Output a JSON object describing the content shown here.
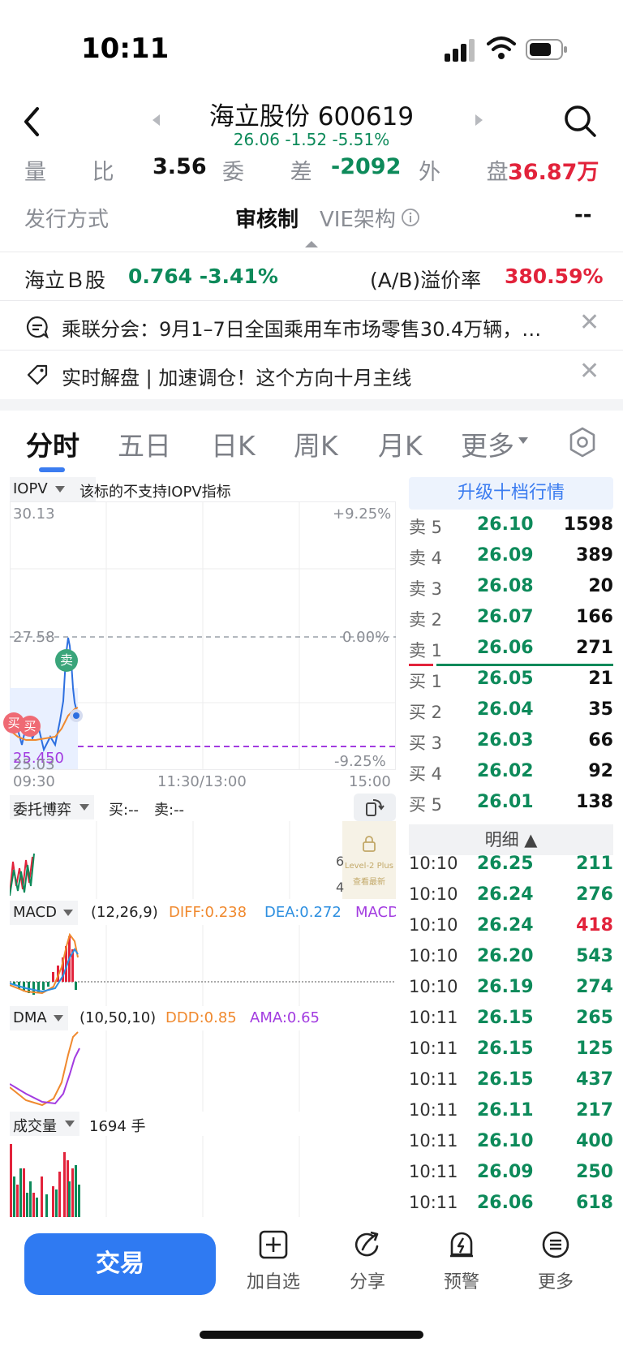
{
  "status_bar": {
    "time": "10:11"
  },
  "header": {
    "title": "海立股份 600619",
    "quote": "26.06  -1.52  -5.51%"
  },
  "stats": {
    "volume_ratio_label": "量  比",
    "volume_ratio": "3.56",
    "commission_diff_label": "委  差",
    "commission_diff": "-2092",
    "outer_label": "外  盘",
    "outer_value": "36.87万"
  },
  "issuance": {
    "label": "发行方式",
    "method": "审核制",
    "vie_label": "VIE架构",
    "vie_value": "--"
  },
  "b_share": {
    "label": "海立Ｂ股",
    "value": "0.764 -3.41%",
    "premium_label": "(A/B)溢价率",
    "premium_value": "380.59%"
  },
  "news": [
    {
      "text": "乘联分会：9月1–7日全国乘用车市场零售30.4万辆，…",
      "icon": "comment-icon"
    },
    {
      "text": "实时解盘 | 加速调仓！这个方向十月主线",
      "icon": "tag-icon"
    }
  ],
  "tabs": [
    "分时",
    "五日",
    "日K",
    "周K",
    "月K",
    "更多"
  ],
  "chart": {
    "indicator_select": "IOPV",
    "indicator_note": "该标的不支持IOPV指标",
    "price_high": "30.13",
    "price_mid": "27.58",
    "price_low_a": "25.450",
    "price_low_b": "25.03",
    "pct_high": "+9.25%",
    "pct_mid": "0.00%",
    "pct_low": "-9.25%",
    "time_start": "09:30",
    "time_mid": "11:30/13:00",
    "time_end": "15:00",
    "sell_marker": "卖",
    "buy_marker": "买",
    "entrust_label": "委托博弈",
    "entrust_buy": "买:--",
    "entrust_sell": "卖:--",
    "level2_line1": "Level-2 Plus",
    "level2_line2": "查看最新",
    "macd_label": "MACD",
    "macd_params": "(12,26,9)",
    "macd_diff": "DIFF:0.238",
    "macd_dea": "DEA:0.272",
    "macd_macd": "MACD",
    "dma_label": "DMA",
    "dma_params": "(10,50,10)",
    "dma_ddd": "DDD:0.85",
    "dma_ama": "AMA:0.65",
    "vol_label": "成交量",
    "vol_value": "1694 手"
  },
  "order_book": {
    "upgrade": "升级十档行情",
    "asks": [
      {
        "label": "卖 5",
        "price": "26.10",
        "vol": "1598"
      },
      {
        "label": "卖 4",
        "price": "26.09",
        "vol": "389"
      },
      {
        "label": "卖 3",
        "price": "26.08",
        "vol": "20"
      },
      {
        "label": "卖 2",
        "price": "26.07",
        "vol": "166"
      },
      {
        "label": "卖 1",
        "price": "26.06",
        "vol": "271"
      }
    ],
    "bids": [
      {
        "label": "买 1",
        "price": "26.05",
        "vol": "21"
      },
      {
        "label": "买 2",
        "price": "26.04",
        "vol": "35"
      },
      {
        "label": "买 3",
        "price": "26.03",
        "vol": "66"
      },
      {
        "label": "买 4",
        "price": "26.02",
        "vol": "92"
      },
      {
        "label": "买 5",
        "price": "26.01",
        "vol": "138"
      }
    ],
    "detail_label": "明细"
  },
  "ticks": [
    {
      "time": "10:10",
      "price": "26.25",
      "vol": "211"
    },
    {
      "time": "10:10",
      "price": "26.24",
      "vol": "276"
    },
    {
      "time": "10:10",
      "price": "26.24",
      "vol": "418"
    },
    {
      "time": "10:10",
      "price": "26.20",
      "vol": "543"
    },
    {
      "time": "10:10",
      "price": "26.19",
      "vol": "274"
    },
    {
      "time": "10:11",
      "price": "26.15",
      "vol": "265"
    },
    {
      "time": "10:11",
      "price": "26.15",
      "vol": "125"
    },
    {
      "time": "10:11",
      "price": "26.15",
      "vol": "437"
    },
    {
      "time": "10:11",
      "price": "26.11",
      "vol": "217"
    },
    {
      "time": "10:11",
      "price": "26.10",
      "vol": "400"
    },
    {
      "time": "10:11",
      "price": "26.09",
      "vol": "250"
    },
    {
      "time": "10:11",
      "price": "26.06",
      "vol": "618"
    }
  ],
  "bottom_bar": {
    "trade": "交易",
    "items": [
      {
        "label": "加自选",
        "icon": "add-watchlist-icon"
      },
      {
        "label": "分享",
        "icon": "share-icon"
      },
      {
        "label": "预警",
        "icon": "alert-icon"
      },
      {
        "label": "更多",
        "icon": "more-icon"
      }
    ]
  },
  "colors": {
    "up": "#e2233b",
    "down": "#0d8a5a",
    "accent": "#2f7af2"
  }
}
